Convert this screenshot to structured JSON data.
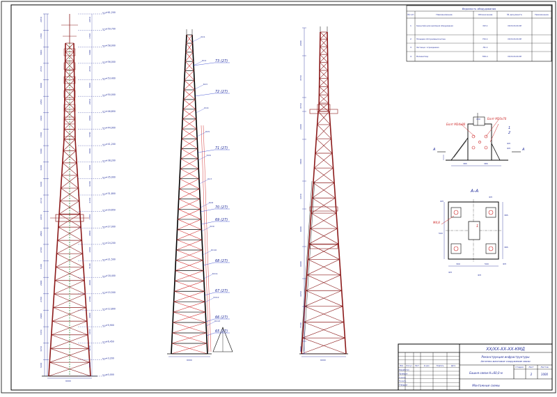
{
  "spec_table": {
    "title": "Ведомость оборудования",
    "headers": [
      "№ п/п",
      "Наименование",
      "Обозначение",
      "№ документа",
      "Примечание"
    ],
    "rows": [
      {
        "num": "1",
        "name": "Кронштейн для крепления оборудования",
        "code": "КР-1",
        "doc": "XX/XX-XX-XX-КМ",
        "note": ""
      },
      {
        "num": "2",
        "name": "Площадка обслуживания антенн",
        "code": "ПО-1",
        "doc": "XX/XX-XX-XX-КМ",
        "note": ""
      },
      {
        "num": "3",
        "name": "Лестница с ограждением",
        "code": "ЛС-1",
        "doc": "",
        "note": ""
      },
      {
        "num": "4",
        "name": "Молниеотвод",
        "code": "МО-1",
        "doc": "XX/XX-XX-XX-КМ",
        "note": ""
      }
    ]
  },
  "tower1": {
    "levels": [
      "+61,200",
      "+59,700",
      "+58,000",
      "+56,000",
      "+53,400",
      "+50,000",
      "+46,850",
      "+44,900",
      "+41,200",
      "+38,200",
      "+35,000",
      "+31,800",
      "+29,650",
      "+27,000",
      "+24,200",
      "+21,500",
      "+18,400",
      "+15,500",
      "+12,800",
      "+9,900",
      "+6,450",
      "+3,200",
      "±0,000"
    ],
    "base_width": "6000"
  },
  "tower2": {
    "callouts": [
      "73 (27)",
      "72 (27)",
      "71 (27)",
      "70 (27)",
      "69 (27)",
      "68 (27)",
      "67 (27)",
      "66 (27)",
      "65 (27)"
    ],
    "base_width": "6000"
  },
  "tower3": {
    "base_width": "6000"
  },
  "details": {
    "bolt_label_1": "Болт М24х80",
    "bolt_label_2": "Болт М20х70",
    "section_label": "А–А",
    "section_mark": "А",
    "mark_1": "1",
    "mark_2": "2",
    "weld": "М4,8",
    "plate_label": "ФП"
  },
  "title_block": {
    "code": "ХХ/ХХ-ХХ-ХХ-КМД",
    "line1": "Реконструкция инфраструктуры",
    "line2": "Антенно-мачтовое сооружение связи",
    "object": "Башня связи Н=60,0 м",
    "sheet_name": "Монтажные схемы",
    "stage_header": "Стадия",
    "sheet_header": "Лист",
    "sheets_header": "Листов",
    "sheet_num": "2",
    "sheets_total": "1000",
    "roles": [
      "Разработал",
      "Проверил",
      "Т.контр.",
      "Н.контр.",
      "Утвердил"
    ],
    "col_headers": [
      "Изм.",
      "Кол.уч.",
      "Лист",
      "№ док.",
      "Подпись",
      "Дата"
    ]
  },
  "colors": {
    "tower": "#8b1a1a",
    "dim": "#1e2a9a",
    "leader": "#2233cc",
    "lattice": "#d43a3a",
    "green": "#2e8b3a",
    "frame": "#000000"
  }
}
